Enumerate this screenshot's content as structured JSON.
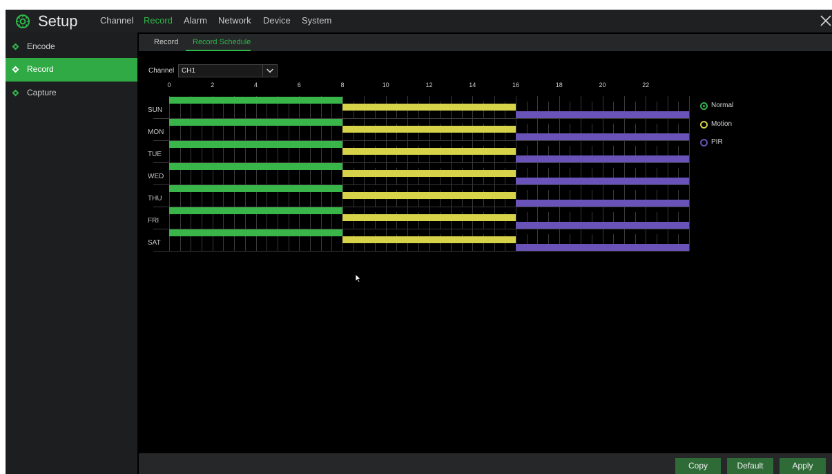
{
  "header": {
    "title": "Setup",
    "tabs": [
      {
        "label": "Channel",
        "active": false
      },
      {
        "label": "Record",
        "active": true
      },
      {
        "label": "Alarm",
        "active": false
      },
      {
        "label": "Network",
        "active": false
      },
      {
        "label": "Device",
        "active": false
      },
      {
        "label": "System",
        "active": false
      }
    ]
  },
  "sidebar": {
    "items": [
      {
        "label": "Encode",
        "active": false
      },
      {
        "label": "Record",
        "active": true
      },
      {
        "label": "Capture",
        "active": false
      }
    ]
  },
  "subtabs": [
    {
      "label": "Record",
      "active": false
    },
    {
      "label": "Record Schedule",
      "active": true
    }
  ],
  "channel": {
    "label": "Channel",
    "value": "CH1"
  },
  "schedule": {
    "hour_ticks": [
      "0",
      "2",
      "4",
      "6",
      "8",
      "10",
      "12",
      "14",
      "16",
      "18",
      "20",
      "22"
    ],
    "days": [
      "SUN",
      "MON",
      "TUE",
      "WED",
      "THU",
      "FRI",
      "SAT"
    ],
    "hours_total": 24,
    "segments": [
      {
        "type": "normal",
        "start": 0,
        "end": 8
      },
      {
        "type": "motion",
        "start": 8,
        "end": 16
      },
      {
        "type": "pir",
        "start": 16,
        "end": 24
      }
    ]
  },
  "legend": [
    {
      "key": "normal",
      "label": "Normal",
      "color": "#39b54a",
      "selected": true
    },
    {
      "key": "motion",
      "label": "Motion",
      "color": "#d6d24a",
      "selected": false
    },
    {
      "key": "pir",
      "label": "PIR",
      "color": "#6a53b8",
      "selected": false
    }
  ],
  "colors": {
    "accent": "#2fb84a",
    "normal": "#39b54a",
    "motion": "#d6d24a",
    "pir": "#6a53b8"
  },
  "footer": {
    "copy_label": "Copy",
    "default_label": "Default",
    "apply_label": "Apply"
  }
}
